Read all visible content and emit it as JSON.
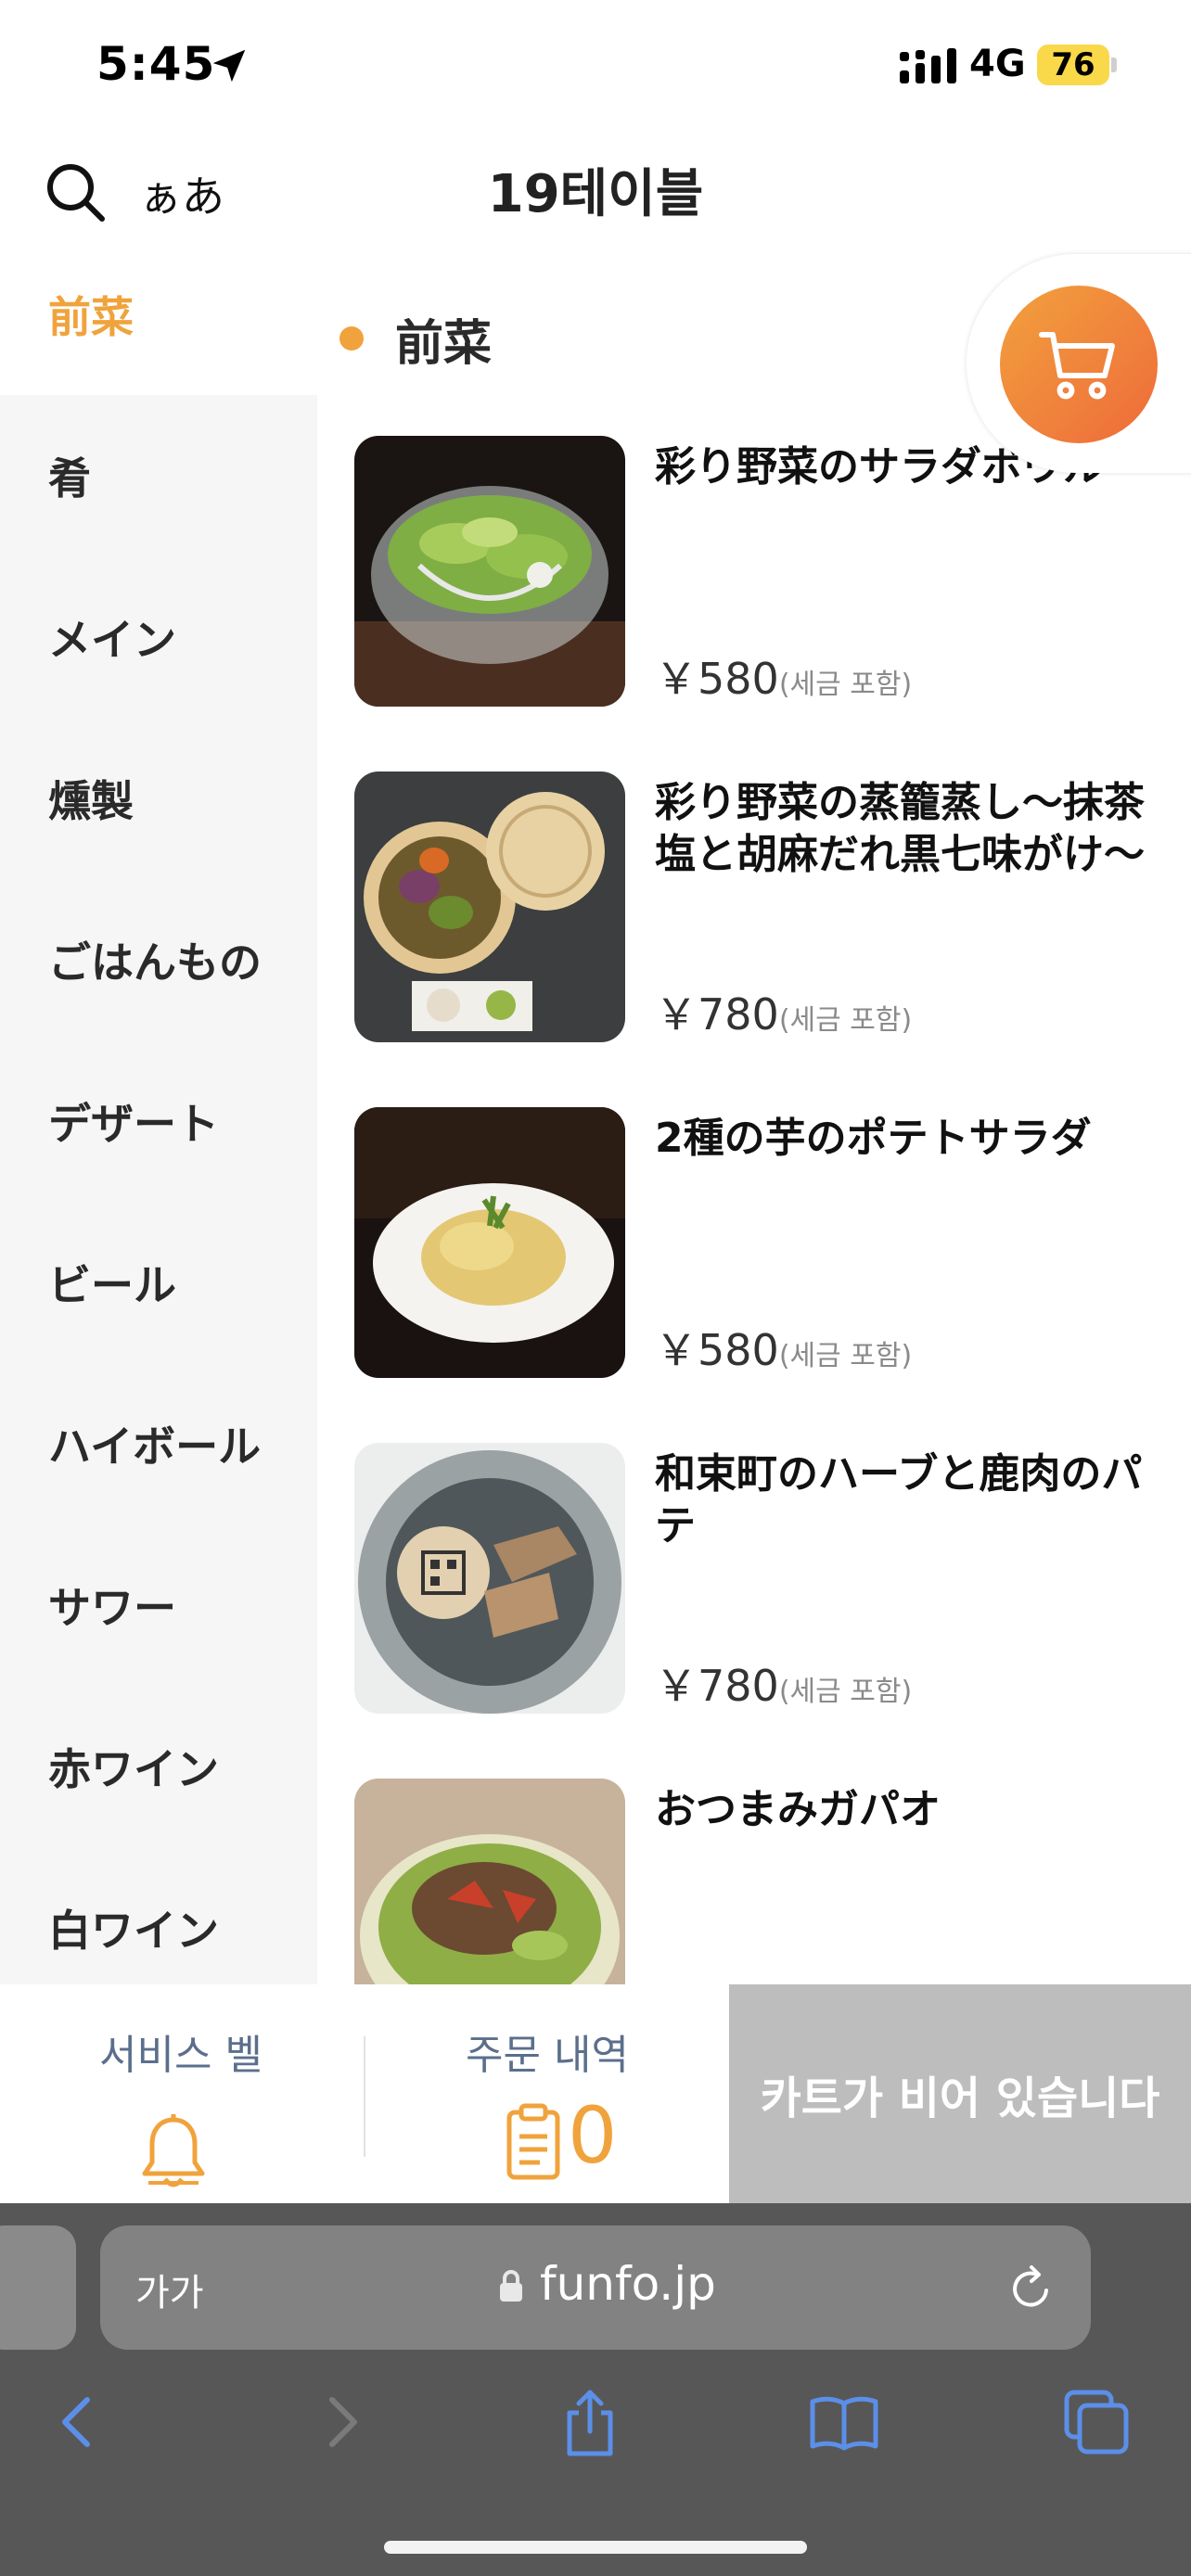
{
  "status_bar": {
    "time": "5:45",
    "network": "4G",
    "battery": "76"
  },
  "header": {
    "kana_toggle": "ぁあ",
    "title": "19테이블"
  },
  "sidebar": {
    "items": [
      {
        "label": "前菜",
        "active": true
      },
      {
        "label": "肴",
        "active": false
      },
      {
        "label": "メイン",
        "active": false
      },
      {
        "label": "燻製",
        "active": false
      },
      {
        "label": "ごはんもの",
        "active": false
      },
      {
        "label": "デザート",
        "active": false
      },
      {
        "label": "ビール",
        "active": false
      },
      {
        "label": "ハイボール",
        "active": false
      },
      {
        "label": "サワー",
        "active": false
      },
      {
        "label": "赤ワイン",
        "active": false
      },
      {
        "label": "白ワイン",
        "active": false
      }
    ]
  },
  "section": {
    "title": "前菜"
  },
  "menu_items": [
    {
      "name": "彩り野菜のサラダボウル",
      "price": "￥580",
      "tax": "(세금 포함)",
      "image": "salad-bowl"
    },
    {
      "name": "彩り野菜の蒸籠蒸し〜抹茶塩と胡麻だれ黒七味がけ〜",
      "price": "￥780",
      "tax": "(세금 포함)",
      "image": "steamed-vegetables"
    },
    {
      "name": "2種の芋のポテトサラダ",
      "price": "￥580",
      "tax": "(세금 포함)",
      "image": "potato-salad"
    },
    {
      "name": "和束町のハーブと鹿肉のパテ",
      "price": "￥780",
      "tax": "(세금 포함)",
      "image": "venison-pate"
    },
    {
      "name": "おつまみガパオ",
      "price": "",
      "tax": "",
      "image": "gapao"
    }
  ],
  "action_bar": {
    "service_bell_label": "서비스 벨",
    "orders_label": "주문 내역",
    "orders_count": "0",
    "checkout_label": "카트가 비어 있습니다"
  },
  "browser": {
    "text_size_label": "가가",
    "url": "funfo.jp"
  },
  "colors": {
    "accent": "#f0a33c",
    "cart_gradient_start": "#f2a13e",
    "cart_gradient_end": "#ee6a3a",
    "checkout_disabled": "#bdbdbd",
    "secondary_label": "#5b6f8c",
    "browser_chrome": "#575757",
    "safari_blue": "#5b8fe8"
  },
  "icons": [
    "search-icon",
    "location-arrow-icon",
    "signal-icon",
    "cart-icon",
    "bell-icon",
    "clipboard-icon",
    "lock-icon",
    "reload-icon",
    "back-icon",
    "forward-icon",
    "share-icon",
    "bookmarks-icon",
    "tabs-icon"
  ]
}
